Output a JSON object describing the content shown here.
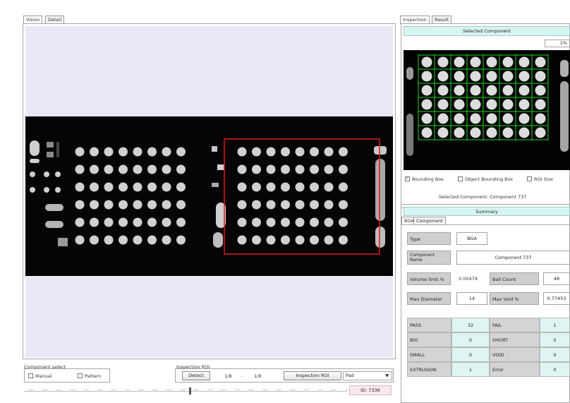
{
  "left_tabs": [
    "Vision",
    "Detail"
  ],
  "right_tabs": [
    "Inspection",
    "Result"
  ],
  "selected_component": {
    "title": "Selected Component",
    "zoom_value": "1%",
    "checkboxes": [
      {
        "label": "Bounding Box",
        "checked": true
      },
      {
        "label": "Object Bounding Box",
        "checked": false
      },
      {
        "label": "ROI Size",
        "checked": false
      }
    ],
    "caption": "Selected Component: Component 737"
  },
  "summary": {
    "title": "Summary",
    "tabs": [
      "BGA",
      "Component"
    ],
    "type_label": "Type",
    "type_value": "BGA",
    "component_name_label": "Component Name",
    "component_name_value": "Component 737",
    "void_limit_label": "Volume limit %",
    "void_limit_value": "0.00479",
    "ball_count_label": "Ball Count",
    "ball_count_value": "48",
    "max_diameter_label": "Max Diameter",
    "max_diameter_value": "14",
    "max_void_label": "Max Void %",
    "max_void_value": "0.77453",
    "results": [
      {
        "l1": "PASS",
        "v1": "32",
        "l2": "FAIL",
        "v2": "1"
      },
      {
        "l1": "BIG",
        "v1": "0",
        "l2": "SHORT",
        "v2": "0"
      },
      {
        "l1": "SMALL",
        "v1": "0",
        "l2": "VOID",
        "v2": "0"
      },
      {
        "l1": "EXTRUSION",
        "v1": "1",
        "l2": "Error",
        "v2": "0"
      }
    ]
  },
  "bottom": {
    "group1_title": "Component select",
    "opt_manual": "Manual",
    "opt_pattern": "Pattern",
    "group2_title": "Inspection ROI",
    "detect_button": "Detect",
    "from_value": "1/8",
    "to_value": "1/8",
    "inspection_roi_button": "Inspection ROI",
    "dropdown_value": "Pad",
    "status": "ID: 7336"
  },
  "colors": {
    "canvas_bg": "#e9e9f6",
    "selection": "#e0191e",
    "grid": "#1fd21f",
    "ball": "#d0d0d0",
    "status_bg": "#f8e8ee"
  }
}
